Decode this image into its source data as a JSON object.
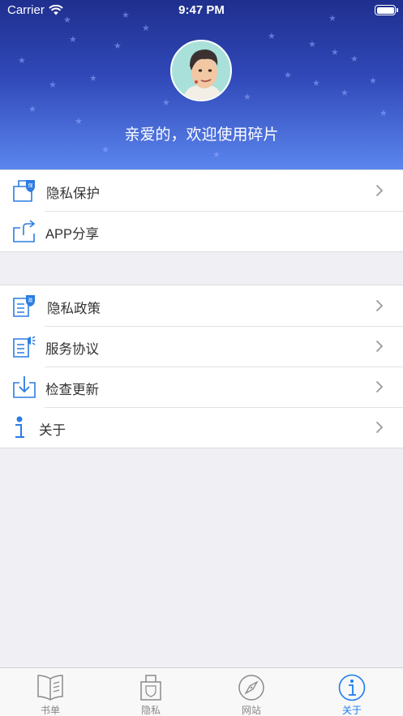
{
  "status_bar": {
    "carrier": "Carrier",
    "time": "9:47 PM"
  },
  "header": {
    "welcome": "亲爱的，欢迎使用碎片"
  },
  "menu_group_1": [
    {
      "label": "隐私保护",
      "icon": "privacy-protect-icon",
      "chevron": true
    },
    {
      "label": "APP分享",
      "icon": "share-icon",
      "chevron": false
    }
  ],
  "menu_group_2": [
    {
      "label": "隐私政策",
      "icon": "policy-icon",
      "chevron": true
    },
    {
      "label": "服务协议",
      "icon": "agreement-icon",
      "chevron": true
    },
    {
      "label": "检查更新",
      "icon": "download-update-icon",
      "chevron": true
    },
    {
      "label": "关于",
      "icon": "info-icon",
      "chevron": true
    }
  ],
  "tabbar": {
    "tabs": [
      {
        "label": "书单",
        "icon": "book-icon",
        "active": false
      },
      {
        "label": "隐私",
        "icon": "lock-icon",
        "active": false
      },
      {
        "label": "网站",
        "icon": "compass-icon",
        "active": false
      },
      {
        "label": "关于",
        "icon": "info-circle-icon",
        "active": true
      }
    ]
  },
  "colors": {
    "accent": "#1b7cf0",
    "header_top": "#1f2f8e",
    "header_bottom": "#5b86ee",
    "background": "#efeff4"
  }
}
